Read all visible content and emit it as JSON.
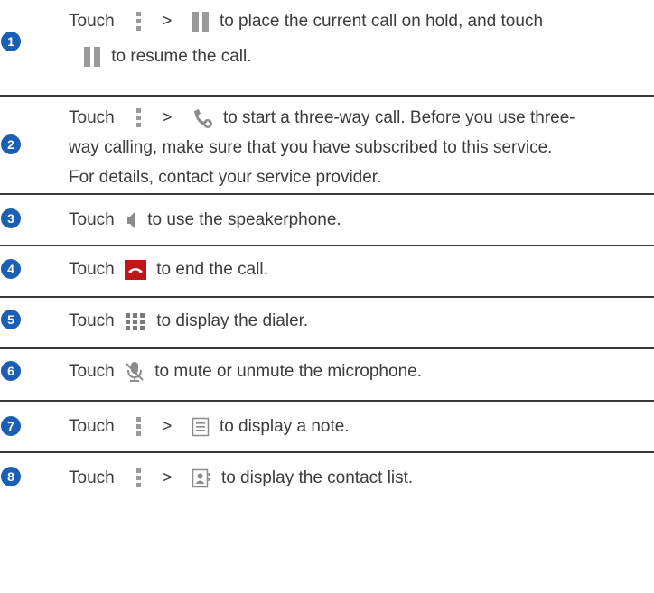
{
  "items": [
    {
      "num": "1",
      "touch": "Touch",
      "sep": ">",
      "a": "to place the current call on hold, and touch",
      "b": "to resume the call."
    },
    {
      "num": "2",
      "touch": "Touch",
      "sep": ">",
      "a": "to start a three-way call. Before you use three-",
      "b": "way calling, make sure that you have subscribed to this service.",
      "c": "For details, contact your service provider."
    },
    {
      "num": "3",
      "touch": "Touch",
      "a": "to use the speakerphone."
    },
    {
      "num": "4",
      "touch": "Touch",
      "a": "to end the call."
    },
    {
      "num": "5",
      "touch": "Touch",
      "a": "to display the dialer."
    },
    {
      "num": "6",
      "touch": "Touch",
      "a": "to mute or unmute the microphone."
    },
    {
      "num": "7",
      "touch": "Touch",
      "sep": ">",
      "a": "to display a note."
    },
    {
      "num": "8",
      "touch": "Touch",
      "sep": ">",
      "a": "to display the contact list."
    }
  ],
  "icons": {
    "menu": "menu-dots-icon",
    "hold": "pause-hold-icon",
    "add_call": "add-call-icon",
    "speaker": "speaker-icon",
    "end_call": "end-call-icon",
    "dialpad": "dialpad-icon",
    "mute": "microphone-mute-icon",
    "note": "note-icon",
    "contacts": "contacts-icon"
  },
  "colors": {
    "number_badge": "#1a5fb4",
    "end_call": "#c0161a",
    "text": "#3c3c3c"
  }
}
